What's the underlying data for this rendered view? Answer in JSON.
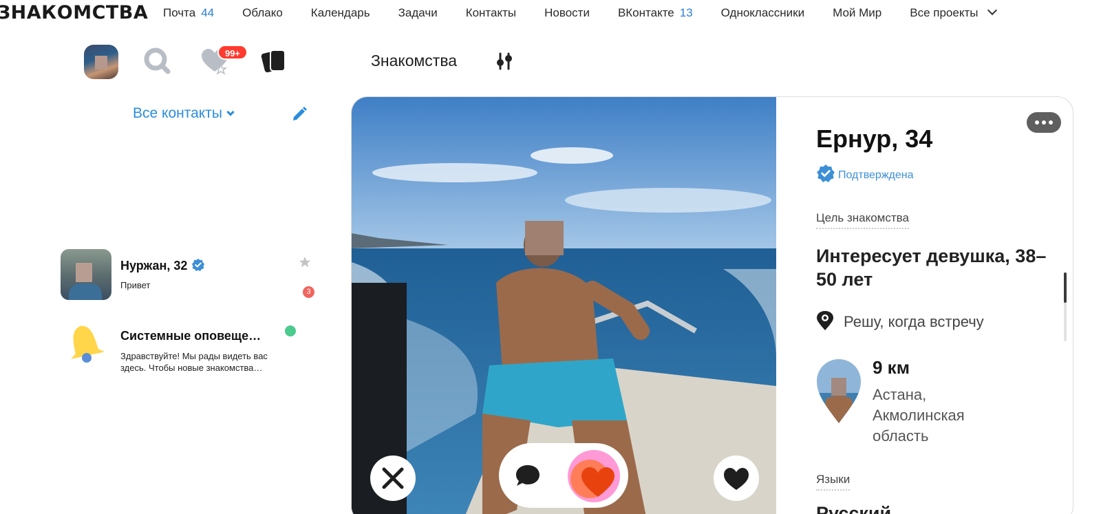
{
  "brand": {
    "logo": "ЗНАКОМСТВА"
  },
  "nav": {
    "items": [
      {
        "label": "Почта",
        "count": "44"
      },
      {
        "label": "Облако"
      },
      {
        "label": "Календарь"
      },
      {
        "label": "Задачи"
      },
      {
        "label": "Контакты"
      },
      {
        "label": "Новости"
      },
      {
        "label": "ВКонтакте",
        "count": "13"
      },
      {
        "label": "Одноклассники"
      },
      {
        "label": "Мой Мир"
      },
      {
        "label": "Все проекты"
      }
    ]
  },
  "toolbar": {
    "likes_badge": "99+"
  },
  "header": {
    "title": "Знакомства"
  },
  "sidebar": {
    "filter_label": "Все контакты",
    "chats": [
      {
        "name": "Нуржан, 32",
        "message": "Привет",
        "unread": "3"
      },
      {
        "name": "Системные оповеще…",
        "message": "Здравствуйте! Мы рады видеть вас здесь. Чтобы новые знакомства…"
      }
    ]
  },
  "profile": {
    "name": "Ернур, 34",
    "verified": "Подтверждена",
    "goal_label": "Цель знакомства",
    "goal": "Интересует девушка, 38–50 лет",
    "meeting": "Решу, когда встречу",
    "distance": "9 км",
    "location": "Астана, Акмолинская область",
    "languages_label": "Языки",
    "language": "Русский"
  },
  "colors": {
    "accent": "#2a8de0",
    "badge": "#ff3b2f",
    "superlike": "#ff5a1f"
  },
  "icons": [
    "search-icon",
    "likes-icon",
    "cards-icon",
    "filter-icon",
    "edit-icon",
    "star-icon",
    "bell-icon",
    "verified-icon",
    "eye-pin-icon",
    "close-icon",
    "chat-icon",
    "heart-icon",
    "more-icon"
  ]
}
